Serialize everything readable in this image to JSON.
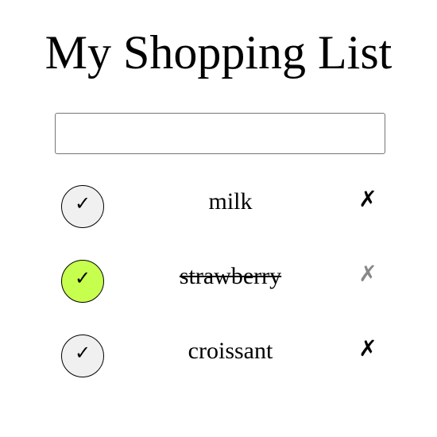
{
  "title": "My Shopping List",
  "input": {
    "value": "",
    "placeholder": ""
  },
  "icons": {
    "check": "✓",
    "delete": "✗"
  },
  "colors": {
    "checked_fill": "#c6ff4e",
    "unchecked_fill": "#f0f0f0",
    "delete_dim": "#888888"
  },
  "items": [
    {
      "label": "milk",
      "checked": false
    },
    {
      "label": "strawberry",
      "checked": true
    },
    {
      "label": "croissant",
      "checked": false
    }
  ]
}
